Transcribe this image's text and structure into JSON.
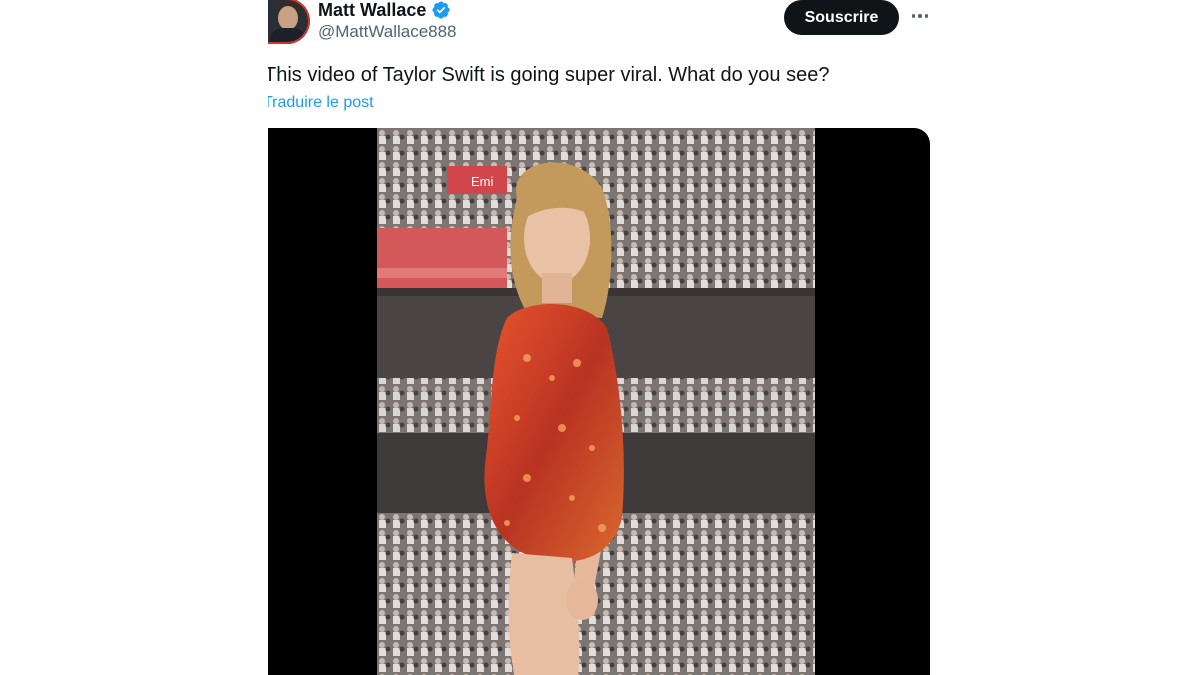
{
  "author": {
    "display_name": "Matt Wallace",
    "handle": "@MattWallace888",
    "verified": true,
    "avatar_icon": "profile-photo"
  },
  "actions": {
    "subscribe_label": "Souscrire",
    "more_icon": "ellipsis-icon"
  },
  "post": {
    "text": "This video of Taylor Swift is going super viral. What do you see?",
    "translate_label": "Traduire le post"
  },
  "media": {
    "type": "video",
    "stadium_sign": "Emi"
  },
  "colors": {
    "link": "#1d9bf0",
    "verified": "#1d9bf0",
    "button_bg": "#0f1419",
    "secondary_text": "#536471"
  }
}
